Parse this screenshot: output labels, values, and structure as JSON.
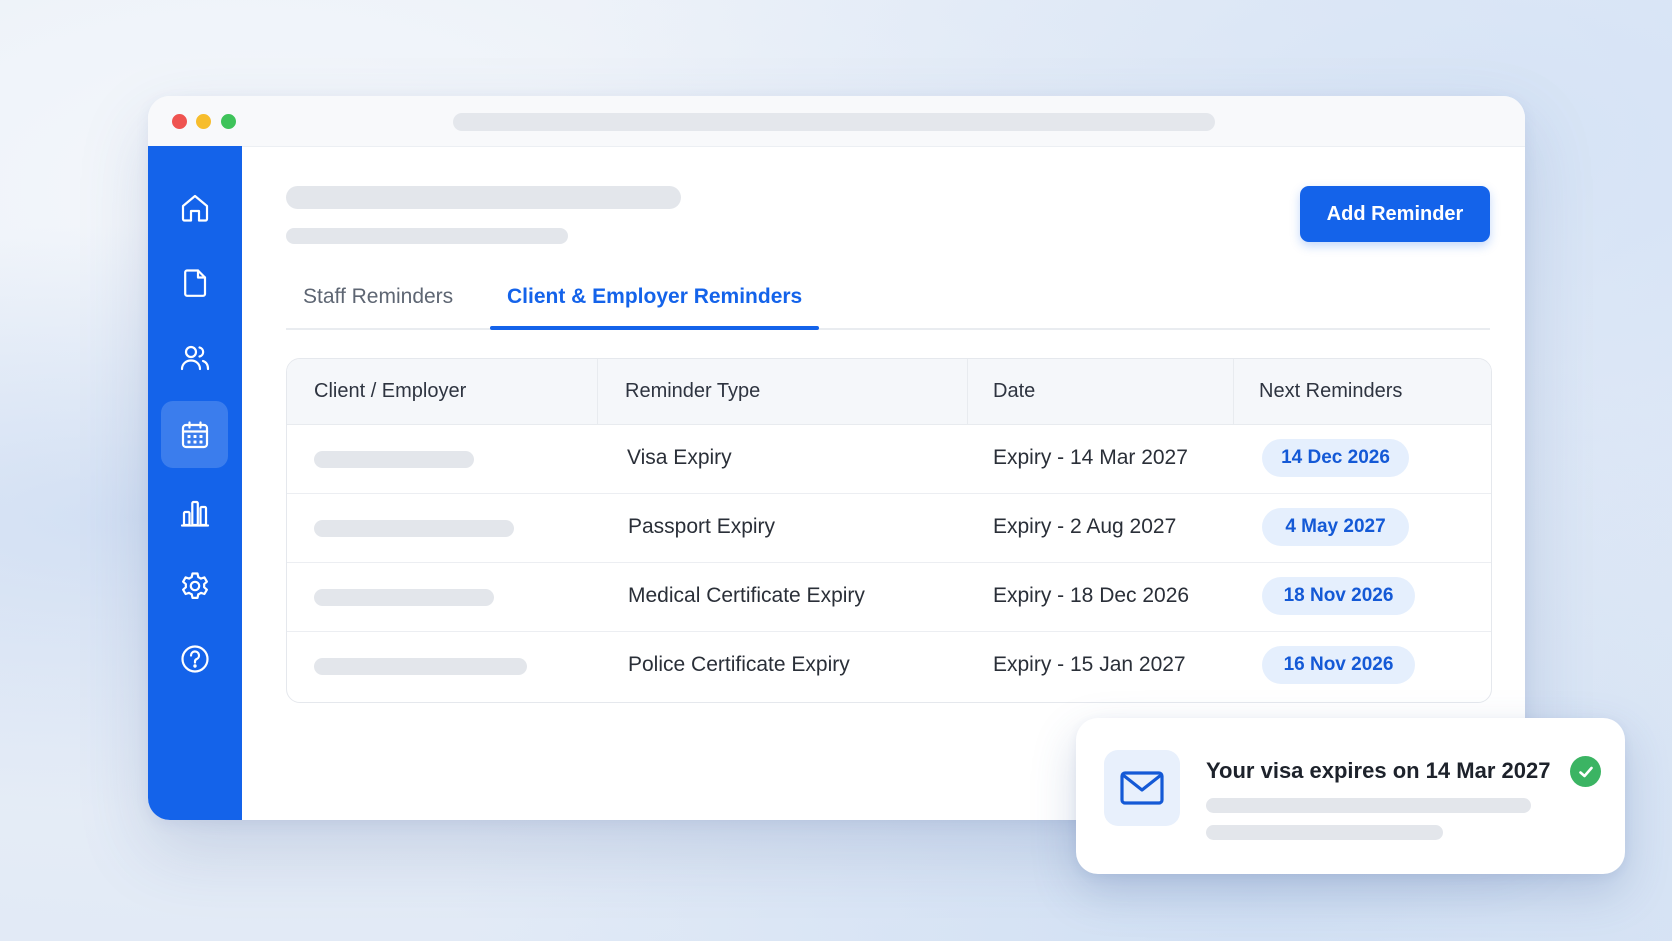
{
  "header": {
    "add_button_label": "Add Reminder"
  },
  "sidebar": {
    "items": [
      {
        "icon": "home-icon",
        "active": false
      },
      {
        "icon": "document-icon",
        "active": false
      },
      {
        "icon": "users-icon",
        "active": false
      },
      {
        "icon": "calendar-icon",
        "active": true
      },
      {
        "icon": "bar-chart-icon",
        "active": false
      },
      {
        "icon": "gear-icon",
        "active": false
      },
      {
        "icon": "help-icon",
        "active": false
      }
    ]
  },
  "tabs": [
    {
      "label": "Staff Reminders",
      "active": false
    },
    {
      "label": "Client & Employer Reminders",
      "active": true
    }
  ],
  "table": {
    "columns": [
      "Client / Employer",
      "Reminder Type",
      "Date",
      "Next Reminders"
    ],
    "rows": [
      {
        "reminder_type": "Visa Expiry",
        "date": "Expiry - 14 Mar 2027",
        "next_reminder": "14 Dec 2026"
      },
      {
        "reminder_type": "Passport Expiry",
        "date": "Expiry - 2 Aug 2027",
        "next_reminder": "4 May 2027"
      },
      {
        "reminder_type": "Medical Certificate Expiry",
        "date": "Expiry - 18 Dec 2026",
        "next_reminder": "18 Nov 2026"
      },
      {
        "reminder_type": "Police Certificate Expiry",
        "date": "Expiry - 15 Jan 2027",
        "next_reminder": "16 Nov 2026"
      }
    ]
  },
  "notification": {
    "title": "Your visa expires on 14 Mar 2027",
    "icon": "mail-icon",
    "status_icon": "check-icon"
  },
  "colors": {
    "accent": "#1463ea",
    "pill_bg": "#e5effd",
    "success": "#3bb463"
  }
}
